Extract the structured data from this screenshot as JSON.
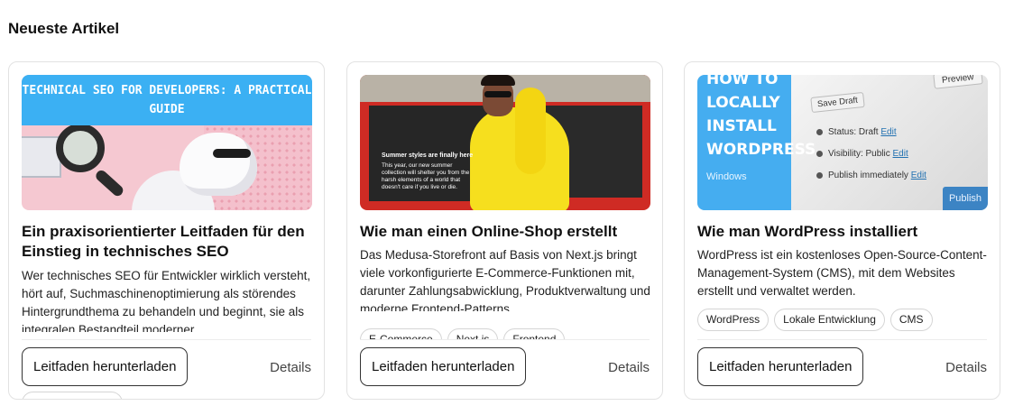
{
  "section": {
    "title": "Neueste Artikel"
  },
  "cards": [
    {
      "image_text": "TECHNICAL SEO FOR DEVELOPERS: A PRACTICAL GUIDE",
      "title": "Ein praxisorientierter Leitfaden für den Einstieg in technisches SEO",
      "body": "Wer technisches SEO für Entwickler wirklich versteht, hört auf, Suchmaschinenoptimierung als störendes Hintergrundthema zu behandeln und beginnt, sie als integralen Bestandteil moderner",
      "button_label": "Leitfaden herunterladen",
      "details_label": "Details"
    },
    {
      "image_caption_title": "Summer styles are finally here",
      "image_caption_text": "This year, our new summer collection will shelter you from the harsh elements of a world that doesn't care if you live or die.",
      "title": "Wie man einen Online-Shop erstellt",
      "body": "Das Medusa-Storefront auf Basis von Next.js bringt viele vorkonfigurierte E-Commerce-Funktionen mit, darunter Zahlungsabwicklung, Produktverwaltung und moderne Frontend-Patterns.",
      "tags": [
        "E-Commerce",
        "Next.js",
        "Frontend"
      ],
      "button_label": "Leitfaden herunterladen",
      "details_label": "Details"
    },
    {
      "image_heading": "HOW TO LOCALLY INSTALL WORDPRESS",
      "image_sub": "Windows",
      "image_ui": {
        "preview": "Preview",
        "save_draft": "Save Draft",
        "status": "Status: Draft",
        "visibility": "Visibility: Public",
        "publish_when": "Publish immediately",
        "edit": "Edit",
        "publish": "Publish"
      },
      "title": "Wie man WordPress installiert",
      "body": "WordPress ist ein kostenloses Open-Source-Content-Management-System (CMS), mit dem Websites erstellt und verwaltet werden.",
      "tags": [
        "WordPress",
        "Lokale Entwicklung",
        "CMS"
      ],
      "button_label": "Leitfaden herunterladen",
      "details_label": "Details"
    }
  ]
}
